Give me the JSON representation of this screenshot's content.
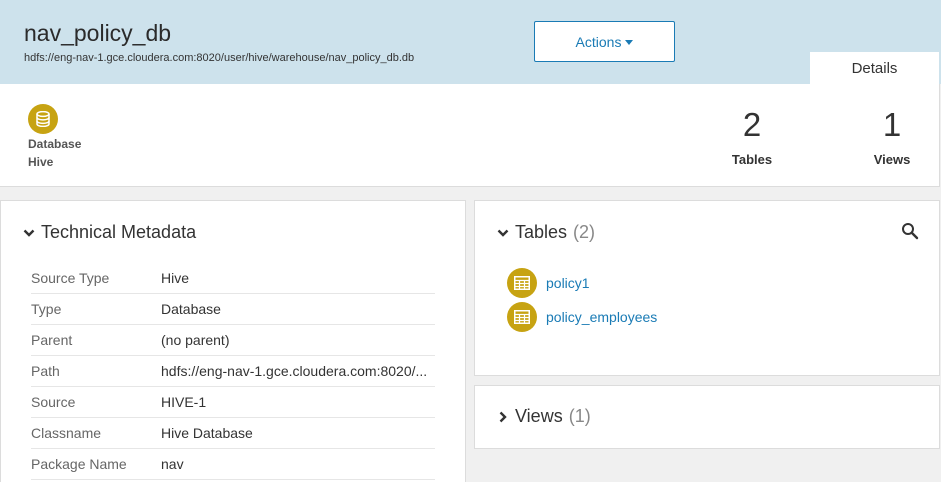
{
  "header": {
    "title": "nav_policy_db",
    "path": "hdfs://eng-nav-1.gce.cloudera.com:8020/user/hive/warehouse/nav_policy_db.db",
    "actions_label": "Actions",
    "details_tab": "Details"
  },
  "summary": {
    "entity_type": "Database",
    "source": "Hive",
    "tables_count": "2",
    "tables_label": "Tables",
    "views_count": "1",
    "views_label": "Views"
  },
  "technical_metadata": {
    "title": "Technical Metadata",
    "rows": [
      {
        "key": "Source Type",
        "value": "Hive"
      },
      {
        "key": "Type",
        "value": "Database"
      },
      {
        "key": "Parent",
        "value": "(no parent)"
      },
      {
        "key": "Path",
        "value": "hdfs://eng-nav-1.gce.cloudera.com:8020/..."
      },
      {
        "key": "Source",
        "value": "HIVE-1"
      },
      {
        "key": "Classname",
        "value": "Hive Database"
      },
      {
        "key": "Package Name",
        "value": "nav"
      }
    ]
  },
  "tables_panel": {
    "title": "Tables",
    "count": "(2)",
    "items": [
      {
        "name": "policy1"
      },
      {
        "name": "policy_employees"
      }
    ]
  },
  "views_panel": {
    "title": "Views",
    "count": "(1)"
  },
  "colors": {
    "header_bg": "#cde2ec",
    "accent_blue": "#1a7bb5",
    "entity_gold": "#c7a312"
  },
  "icons": [
    "database-icon",
    "table-icon",
    "search-icon",
    "chevron-down-icon",
    "chevron-right-icon",
    "caret-down-icon"
  ]
}
